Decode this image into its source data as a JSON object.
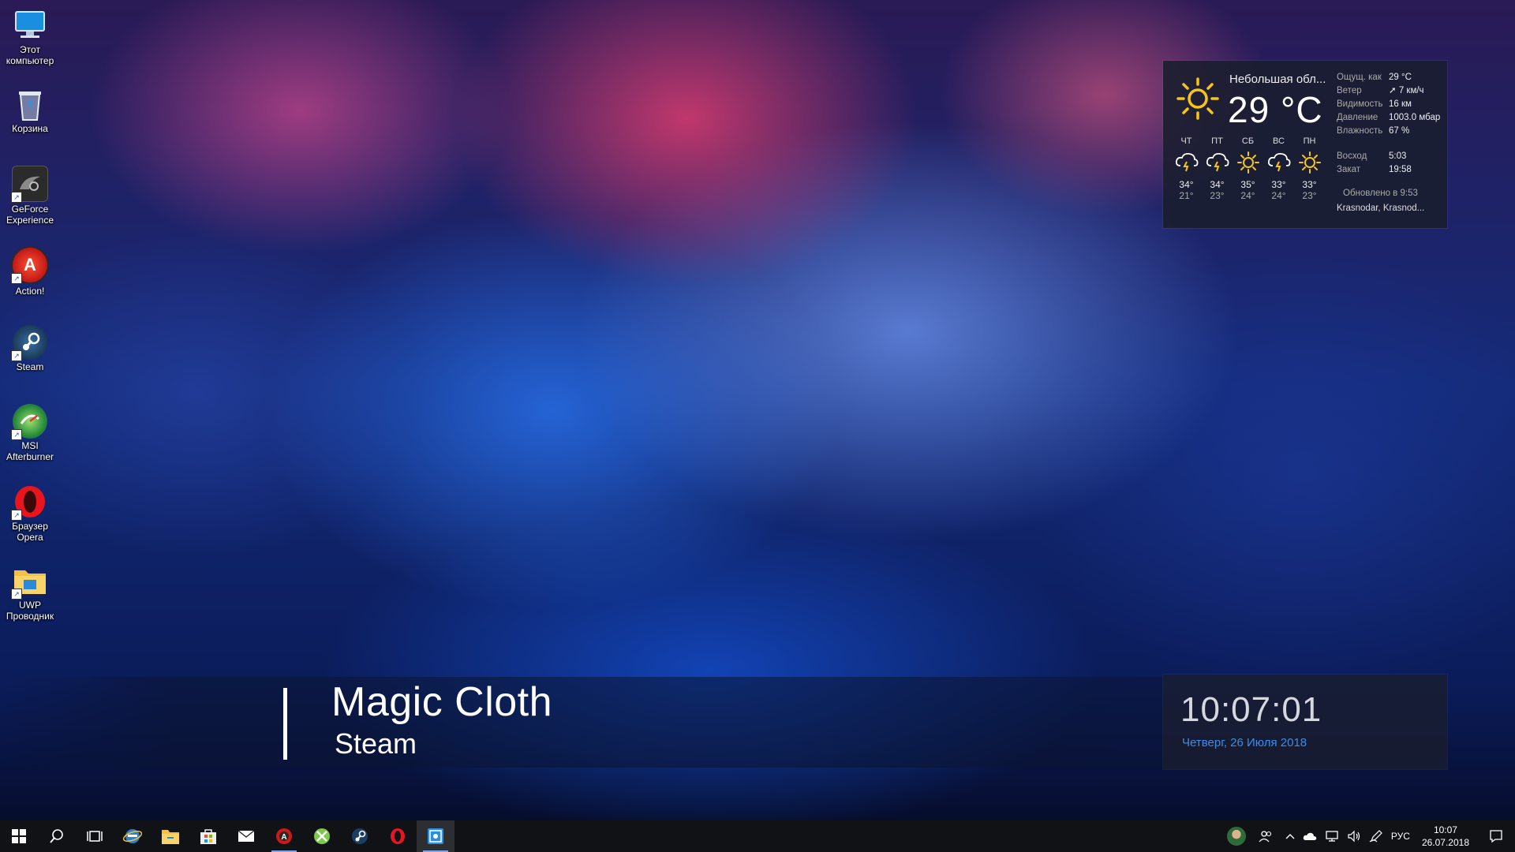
{
  "desktop": {
    "icons": [
      {
        "name": "desktop-icon-this-pc",
        "label": "Этот\nкомпьютер",
        "icon": "monitor-icon"
      },
      {
        "name": "desktop-icon-recycle-bin",
        "label": "Корзина",
        "icon": "recycle-bin-icon"
      },
      {
        "name": "desktop-icon-geforce",
        "label": "GeForce\nExperience",
        "icon": "geforce-icon"
      },
      {
        "name": "desktop-icon-action",
        "label": "Action!",
        "icon": "action-icon"
      },
      {
        "name": "desktop-icon-steam",
        "label": "Steam",
        "icon": "steam-icon"
      },
      {
        "name": "desktop-icon-afterburner",
        "label": "MSI\nAfterburner",
        "icon": "afterburner-icon"
      },
      {
        "name": "desktop-icon-opera",
        "label": "Браузер\nOpera",
        "icon": "opera-icon"
      },
      {
        "name": "desktop-icon-uwp-explorer",
        "label": "UWP\nПроводник",
        "icon": "folder-icon"
      }
    ]
  },
  "weather": {
    "condition": "Небольшая обл...",
    "temp": "29 °C",
    "details": [
      {
        "k": "Ощущ. как",
        "v": "29 °C"
      },
      {
        "k": "Ветер",
        "v": "➚ 7 км/ч"
      },
      {
        "k": "Видимость",
        "v": "16 км"
      },
      {
        "k": "Давление",
        "v": "1003.0 мбар"
      },
      {
        "k": "Влажность",
        "v": "67 %"
      }
    ],
    "sunrise": {
      "k": "Восход",
      "v": "5:03"
    },
    "sunset": {
      "k": "Закат",
      "v": "19:58"
    },
    "updated": "Обновлено в 9:53",
    "location": "Krasnodar, Krasnod...",
    "forecast": [
      {
        "day": "ЧТ",
        "icon": "storm-cloud-icon",
        "hi": "34°",
        "lo": "21°"
      },
      {
        "day": "ПТ",
        "icon": "storm-cloud-icon",
        "hi": "34°",
        "lo": "23°"
      },
      {
        "day": "СБ",
        "icon": "sun-icon",
        "hi": "35°",
        "lo": "24°"
      },
      {
        "day": "ВС",
        "icon": "storm-cloud-icon",
        "hi": "33°",
        "lo": "24°"
      },
      {
        "day": "ПН",
        "icon": "sun-icon",
        "hi": "33°",
        "lo": "23°"
      }
    ]
  },
  "banner": {
    "title": "Magic Cloth",
    "subtitle": "Steam"
  },
  "clock": {
    "time": "10:07:01",
    "date": "Четверг, 26 Июля 2018"
  },
  "taskbar": {
    "apps": [
      {
        "name": "taskbar-start-button",
        "icon": "windows-icon"
      },
      {
        "name": "taskbar-search-button",
        "icon": "search-icon"
      },
      {
        "name": "taskbar-task-view-button",
        "icon": "task-view-icon"
      },
      {
        "name": "taskbar-app-ie",
        "icon": "browser-icon"
      },
      {
        "name": "taskbar-app-explorer",
        "icon": "folder-icon"
      },
      {
        "name": "taskbar-app-store",
        "icon": "store-icon"
      },
      {
        "name": "taskbar-app-mail",
        "icon": "mail-icon"
      },
      {
        "name": "taskbar-app-action",
        "icon": "action-icon"
      },
      {
        "name": "taskbar-app-xbox",
        "icon": "xbox-icon"
      },
      {
        "name": "taskbar-app-steam",
        "icon": "steam-icon"
      },
      {
        "name": "taskbar-app-opera",
        "icon": "opera-icon"
      },
      {
        "name": "taskbar-app-wallpaper-engine",
        "icon": "wallpaper-engine-icon"
      }
    ],
    "language": "РУС",
    "clock_time": "10:07",
    "clock_date": "26.07.2018"
  },
  "colors": {
    "accent": "#3c8de8",
    "taskbar": "#101216",
    "widget_bg": "#191e2d"
  }
}
